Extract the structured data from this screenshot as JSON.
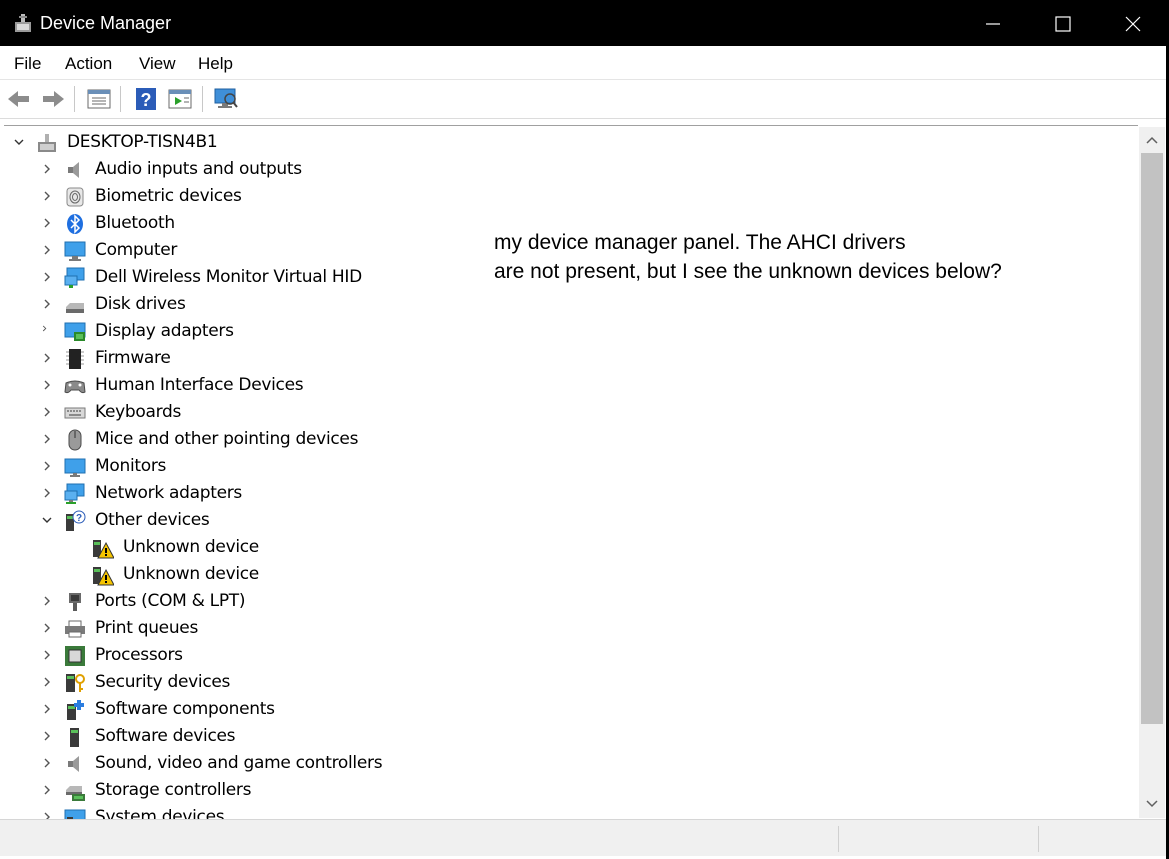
{
  "window": {
    "title": "Device Manager"
  },
  "menu": [
    "File",
    "Action",
    "View",
    "Help"
  ],
  "toolbar": {
    "buttons": [
      "back-icon",
      "forward-icon",
      "properties-icon",
      "help-icon",
      "update-driver-icon",
      "scan-hardware-icon"
    ]
  },
  "tree": {
    "root": "DESKTOP-TISN4B1",
    "items": [
      {
        "label": "Audio inputs and outputs",
        "icon": "speaker-icon",
        "expanded": false
      },
      {
        "label": "Biometric devices",
        "icon": "fingerprint-icon",
        "expanded": false
      },
      {
        "label": "Bluetooth",
        "icon": "bluetooth-icon",
        "expanded": false
      },
      {
        "label": "Computer",
        "icon": "computer-icon",
        "expanded": false
      },
      {
        "label": "Dell Wireless Monitor Virtual HID",
        "icon": "network-monitor-icon",
        "expanded": false
      },
      {
        "label": "Disk drives",
        "icon": "disk-drive-icon",
        "expanded": false
      },
      {
        "label": "Display adapters",
        "icon": "display-adapter-icon",
        "expanded": false
      },
      {
        "label": "Firmware",
        "icon": "chip-icon",
        "expanded": false
      },
      {
        "label": "Human Interface Devices",
        "icon": "gamepad-icon",
        "expanded": false
      },
      {
        "label": "Keyboards",
        "icon": "keyboard-icon",
        "expanded": false
      },
      {
        "label": "Mice and other pointing devices",
        "icon": "mouse-icon",
        "expanded": false
      },
      {
        "label": "Monitors",
        "icon": "monitor-icon",
        "expanded": false
      },
      {
        "label": "Network adapters",
        "icon": "network-adapter-icon",
        "expanded": false
      },
      {
        "label": "Other devices",
        "icon": "unknown-category-icon",
        "expanded": true,
        "children": [
          {
            "label": "Unknown device",
            "icon": "warning-device-icon"
          },
          {
            "label": "Unknown device",
            "icon": "warning-device-icon"
          }
        ]
      },
      {
        "label": "Ports (COM & LPT)",
        "icon": "port-icon",
        "expanded": false
      },
      {
        "label": "Print queues",
        "icon": "printer-icon",
        "expanded": false
      },
      {
        "label": "Processors",
        "icon": "processor-icon",
        "expanded": false
      },
      {
        "label": "Security devices",
        "icon": "security-key-icon",
        "expanded": false
      },
      {
        "label": "Software components",
        "icon": "software-component-icon",
        "expanded": false
      },
      {
        "label": "Software devices",
        "icon": "software-device-icon",
        "expanded": false
      },
      {
        "label": "Sound, video and game controllers",
        "icon": "speaker-icon",
        "expanded": false
      },
      {
        "label": "Storage controllers",
        "icon": "storage-controller-icon",
        "expanded": false
      },
      {
        "label": "System devices",
        "icon": "system-device-icon",
        "expanded": false
      }
    ]
  },
  "annotation": {
    "line1": "my device manager panel. The AHCI drivers",
    "line2": "are not present, but I see the unknown devices below?"
  },
  "colors": {
    "titlebar": "#000000",
    "accent": "#0078d7",
    "warning": "#f5c400"
  }
}
